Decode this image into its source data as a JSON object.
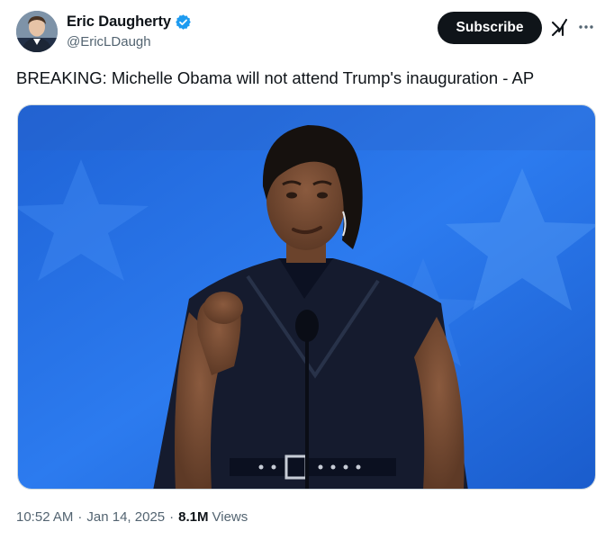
{
  "author": {
    "name": "Eric Daugherty",
    "handle": "@EricLDaugh",
    "verified": true,
    "verified_color": "#1d9bf0"
  },
  "actions": {
    "subscribe_label": "Subscribe",
    "grok_icon": "grok-icon",
    "more_icon": "more-horizontal-icon"
  },
  "tweet": {
    "text": "BREAKING: Michelle Obama will not attend Trump's inauguration - AP"
  },
  "media": {
    "type": "photo",
    "background_color": "#1f6fe0"
  },
  "meta": {
    "time": "10:52 AM",
    "separator": "·",
    "date": "Jan 14, 2025",
    "views_count": "8.1M",
    "views_label": "Views"
  }
}
